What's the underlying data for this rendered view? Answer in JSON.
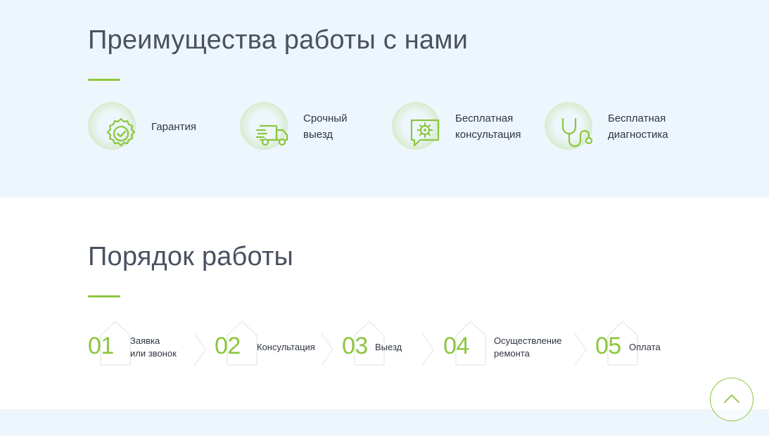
{
  "advantages": {
    "title": "Преимущества работы с нами",
    "items": [
      {
        "label": "Гарантия",
        "icon": "guarantee-badge-icon"
      },
      {
        "label": "Срочный выезд",
        "icon": "delivery-truck-icon"
      },
      {
        "label": "Бесплатная консультация",
        "icon": "chat-gear-icon"
      },
      {
        "label": "Бесплатная диагностика",
        "icon": "stethoscope-icon"
      }
    ]
  },
  "workflow": {
    "title": "Порядок работы",
    "steps": [
      {
        "number": "01",
        "label_line1": "Заявка",
        "label_line2": "или звонок"
      },
      {
        "number": "02",
        "label_line1": "Консультация",
        "label_line2": ""
      },
      {
        "number": "03",
        "label_line1": "Выезд",
        "label_line2": ""
      },
      {
        "number": "04",
        "label_line1": "Осуществление",
        "label_line2": "ремонта"
      },
      {
        "number": "05",
        "label_line1": "Оплата",
        "label_line2": ""
      }
    ]
  },
  "scroll_top": {
    "icon": "chevron-up-icon"
  },
  "colors": {
    "accent": "#8cc63f",
    "heading": "#4a5160",
    "band": "#eef6fd"
  }
}
